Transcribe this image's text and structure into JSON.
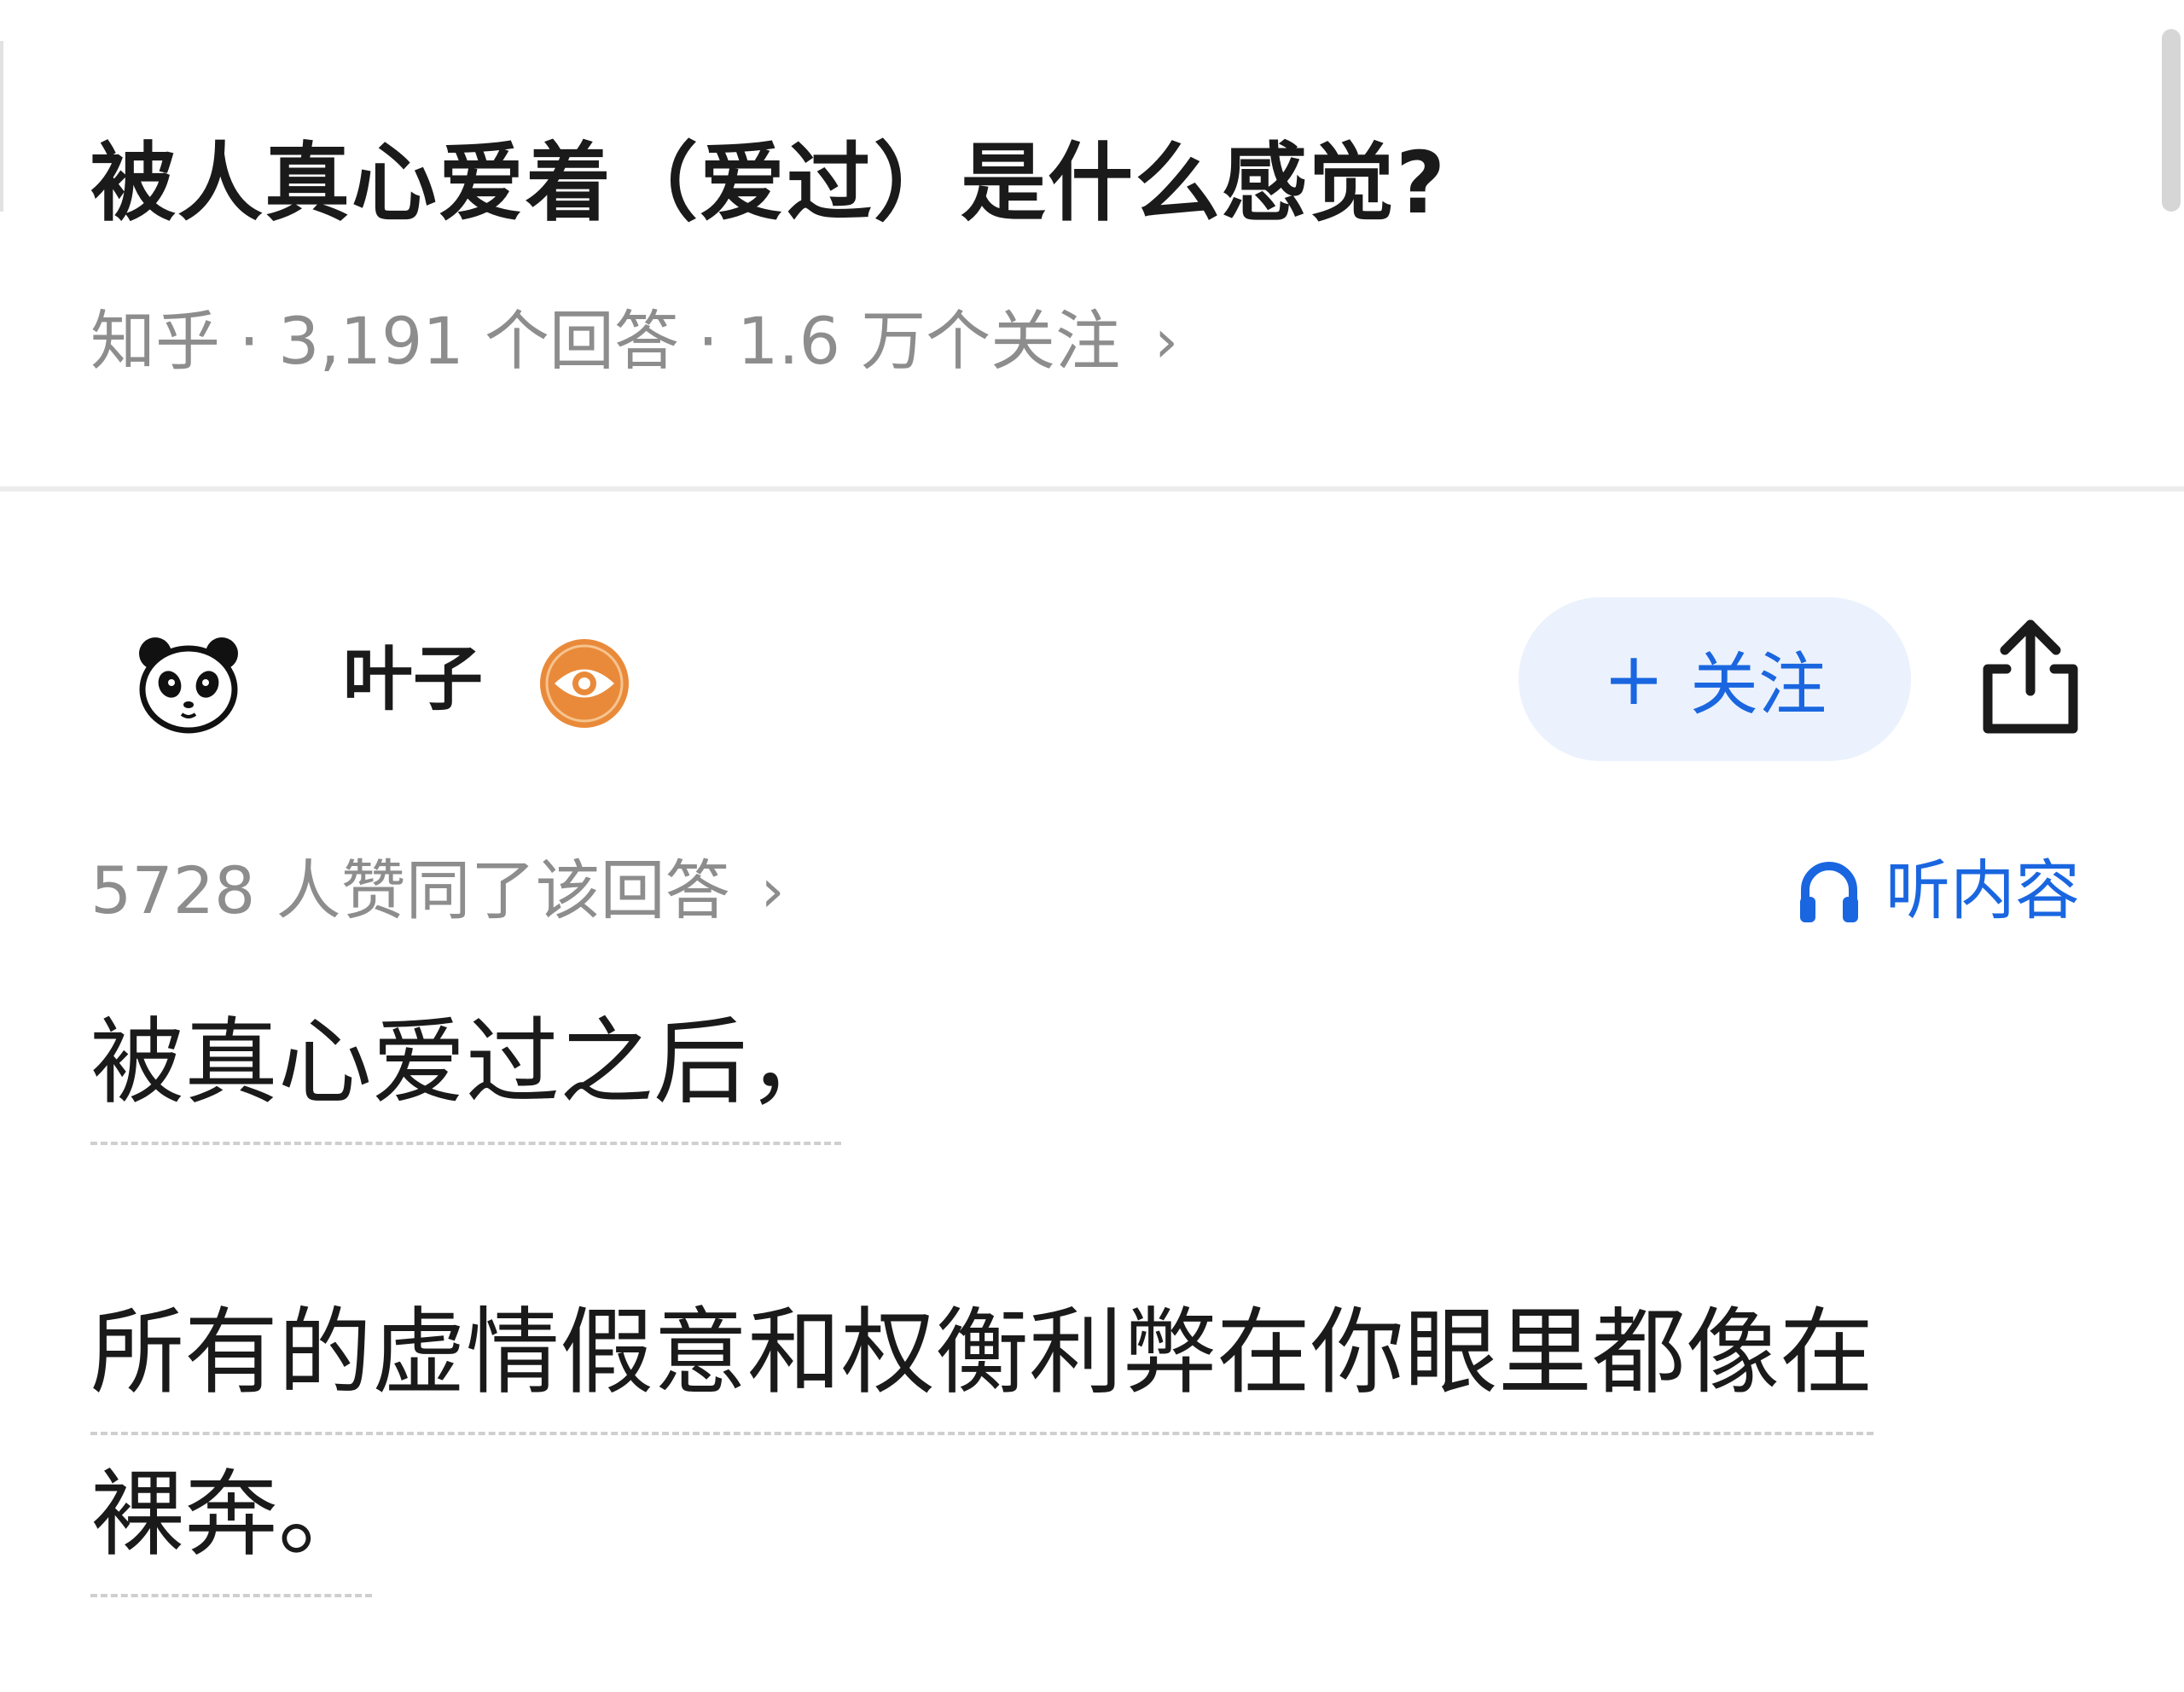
{
  "question": {
    "title": "被人真心爱着（爱过）是什么感觉?",
    "source": "知乎",
    "answers": "3,191 个回答",
    "followers": "1.6 万个关注",
    "separator": "·",
    "chevron": "›"
  },
  "author": {
    "name": "叶子",
    "avatar_icon": "panda-avatar",
    "badge_icon": "eye-badge-icon",
    "follow_label": "关注",
    "follow_plus": "+"
  },
  "answer": {
    "upvotes_text": "5728 人赞同了该回答",
    "listen_label": "听内容",
    "paragraphs": [
      "被真心爱过之后，",
      "所有的虚情假意和权衡利弊在你眼里都像在",
      "裸奔。"
    ]
  },
  "colors": {
    "accent": "#1a66e0",
    "follow_bg": "#ebf2fd",
    "meta_gray": "#8d8d8d",
    "badge_orange": "#e98a3a"
  }
}
